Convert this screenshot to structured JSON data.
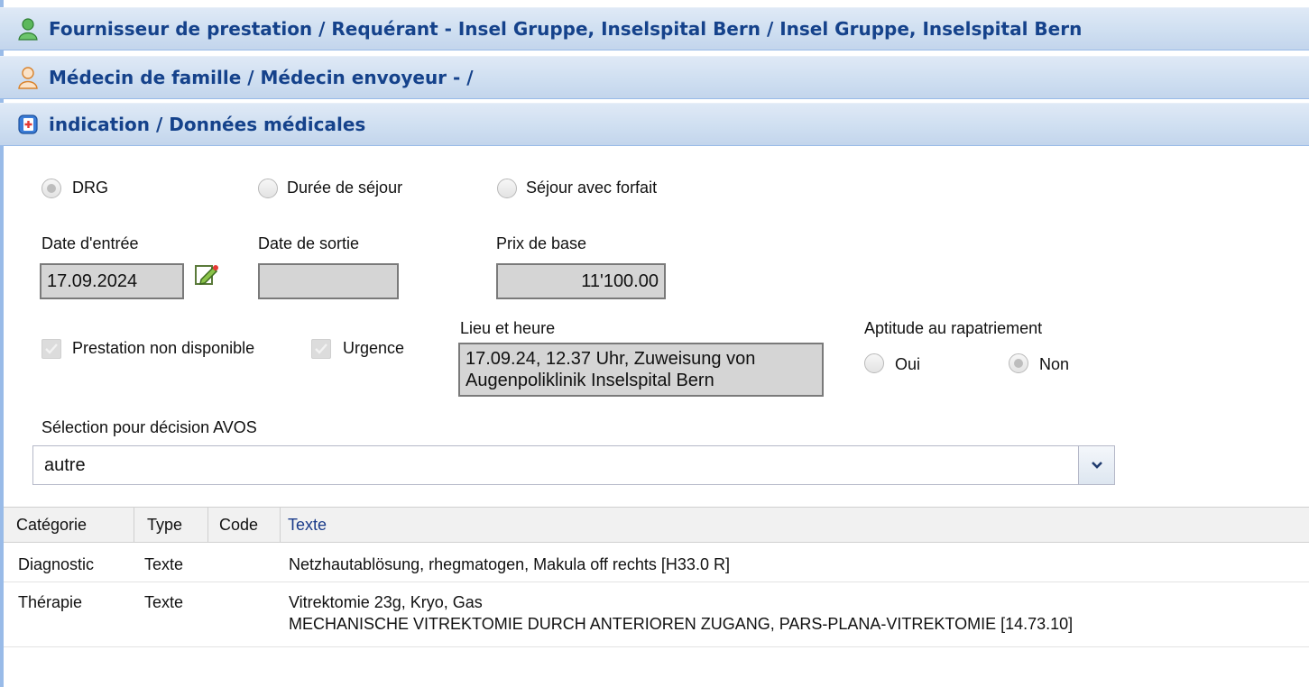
{
  "panels": [
    {
      "title": "Fournisseur de prestation / Requérant - Insel Gruppe, Inselspital Bern / Insel Gruppe, Inselspital Bern",
      "icon": "green-user-icon"
    },
    {
      "title": "Médecin de famille / Médecin envoyeur - /",
      "icon": "orange-user-icon"
    },
    {
      "title": "indication / Données médicales",
      "icon": "medical-record-icon"
    }
  ],
  "billing_type": {
    "options": [
      "DRG",
      "Durée de séjour",
      "Séjour avec forfait"
    ],
    "selected": "DRG"
  },
  "dates": {
    "entry_label": "Date d'entrée",
    "entry_value": "17.09.2024",
    "exit_label": "Date de sortie",
    "exit_value": "",
    "base_price_label": "Prix de base",
    "base_price_value": "11'100.00"
  },
  "flags": {
    "not_available_label": "Prestation non disponible",
    "not_available_checked": true,
    "urgent_label": "Urgence",
    "urgent_checked": true
  },
  "place_time": {
    "label": "Lieu et heure",
    "value": "17.09.24, 12.37 Uhr, Zuweisung von Augenpoliklinik Inselspital Bern"
  },
  "repatriation": {
    "label": "Aptitude au rapatriement",
    "options": [
      "Oui",
      "Non"
    ],
    "selected": "Non"
  },
  "avos": {
    "label": "Sélection pour décision AVOS",
    "value": "autre"
  },
  "table": {
    "columns": [
      "Catégorie",
      "Type",
      "Code",
      "Texte"
    ],
    "rows": [
      {
        "category": "Diagnostic",
        "type": "Texte",
        "code": "",
        "text_lines": [
          "Netzhautablösung, rhegmatogen, Makula off rechts [H33.0 R]"
        ]
      },
      {
        "category": "Thérapie",
        "type": "Texte",
        "code": "",
        "text_lines": [
          "Vitrektomie 23g, Kryo, Gas",
          "MECHANISCHE VITREKTOMIE DURCH ANTERIOREN ZUGANG, PARS-PLANA-VITREKTOMIE [14.73.10]"
        ]
      }
    ]
  },
  "colors": {
    "header_text": "#15428b",
    "header_bg": "#cfdff1",
    "field_bg": "#d5d5d5"
  }
}
